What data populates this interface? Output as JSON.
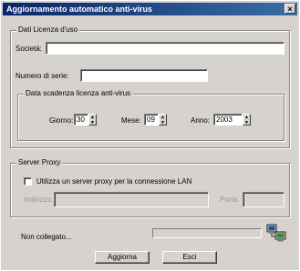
{
  "window": {
    "title": "Aggiornamento automatico anti-virus",
    "close_glyph": "×"
  },
  "license_group": {
    "legend": "Dati Licenza d'uso",
    "company_label": "Società:",
    "company_value": "",
    "serial_label": "Numero di serie:",
    "serial_value": ""
  },
  "expiry_group": {
    "legend": "Data scadenza licenza anti-virus",
    "day_label": "Giorno:",
    "day_value": "30",
    "month_label": "Mese:",
    "month_value": "09",
    "year_label": "Anno:",
    "year_value": "2003"
  },
  "proxy_group": {
    "legend": "Server Proxy",
    "use_proxy_label": "Utilizza un server proxy per la connessione LAN",
    "use_proxy_checked": false,
    "address_label": "Indirizzo:",
    "address_value": "",
    "port_label": "Porta:",
    "port_value": ""
  },
  "status": {
    "text": "Non collegato...",
    "progress": 0,
    "network_icon": "network-computers-icon"
  },
  "buttons": {
    "update_label": "Aggiorna",
    "exit_label": "Esci"
  }
}
